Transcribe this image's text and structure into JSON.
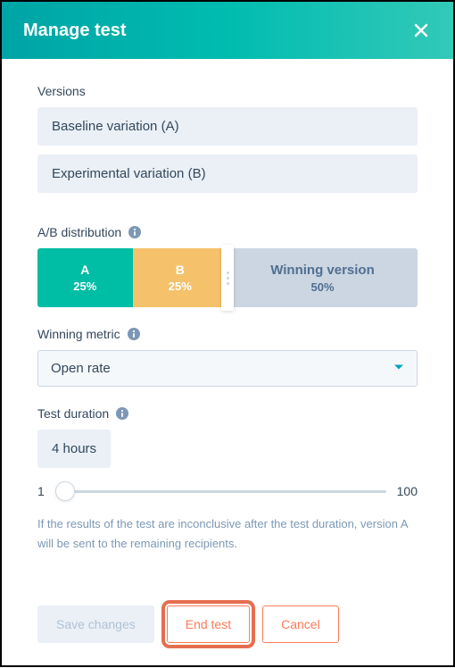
{
  "header": {
    "title": "Manage test"
  },
  "versions": {
    "label": "Versions",
    "items": [
      "Baseline variation (A)",
      "Experimental variation (B)"
    ]
  },
  "distribution": {
    "label": "A/B distribution",
    "a": {
      "label": "A",
      "pct": "25%"
    },
    "b": {
      "label": "B",
      "pct": "25%"
    },
    "winning": {
      "label": "Winning version",
      "pct": "50%"
    }
  },
  "metric": {
    "label": "Winning metric",
    "selected": "Open rate"
  },
  "duration": {
    "label": "Test duration",
    "value": "4 hours",
    "min": "1",
    "max": "100"
  },
  "note": "If the results of the test are inconclusive after the test duration, version A will be sent to the remaining recipients.",
  "footer": {
    "save": "Save changes",
    "end": "End test",
    "cancel": "Cancel"
  }
}
